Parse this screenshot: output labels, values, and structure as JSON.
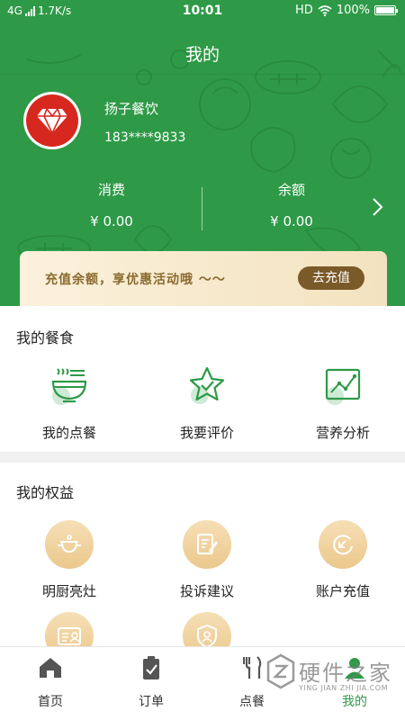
{
  "status_bar": {
    "network": "4G",
    "speed": "1.7K/s",
    "time": "10:01",
    "hd": "HD",
    "battery": "100%"
  },
  "header": {
    "title": "我的",
    "user_name": "扬子餐饮",
    "user_phone": "183****9833",
    "stats": [
      {
        "label": "消费",
        "value": "¥ 0.00"
      },
      {
        "label": "余额",
        "value": "¥ 0.00"
      }
    ]
  },
  "recharge": {
    "text": "充值余额，享优惠活动哦 ～～",
    "button": "去充值"
  },
  "my_food": {
    "title": "我的餐食",
    "items": [
      {
        "label": "我的点餐",
        "icon": "bowl-icon"
      },
      {
        "label": "我要评价",
        "icon": "star-icon"
      },
      {
        "label": "营养分析",
        "icon": "chart-icon"
      }
    ]
  },
  "my_rights": {
    "title": "我的权益",
    "items": [
      {
        "label": "明厨亮灶",
        "icon": "chef-pot-icon"
      },
      {
        "label": "投诉建议",
        "icon": "complaint-doc-icon"
      },
      {
        "label": "账户充值",
        "icon": "recharge-icon"
      },
      {
        "label": "",
        "icon": "id-card-icon"
      },
      {
        "label": "",
        "icon": "shield-user-icon"
      }
    ]
  },
  "tabbar": {
    "tabs": [
      {
        "label": "首页",
        "icon": "home-icon"
      },
      {
        "label": "订单",
        "icon": "clipboard-icon"
      },
      {
        "label": "点餐",
        "icon": "order-food-icon"
      },
      {
        "label": "我的",
        "icon": "user-icon"
      }
    ],
    "active": "我的"
  },
  "watermark": {
    "big": "硬件之家",
    "small": "YING JIAN ZHI JIA.COM"
  },
  "colors": {
    "primary_green": "#2e9a47",
    "gold": "#7b5a2a",
    "avatar_red": "#d7281f"
  }
}
